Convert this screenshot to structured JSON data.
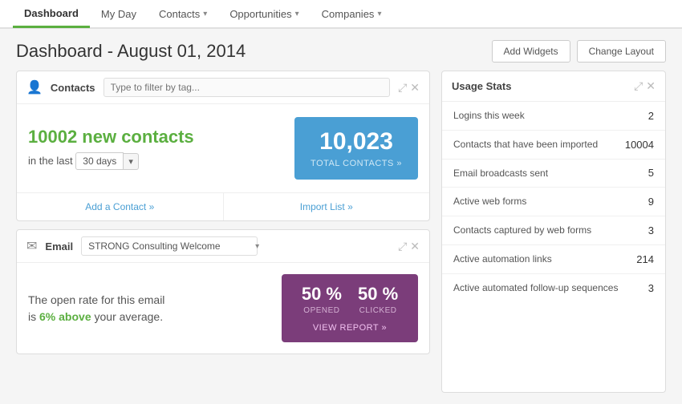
{
  "nav": {
    "items": [
      {
        "label": "Dashboard",
        "active": true,
        "hasChevron": false
      },
      {
        "label": "My Day",
        "active": false,
        "hasChevron": false
      },
      {
        "label": "Contacts",
        "active": false,
        "hasChevron": true
      },
      {
        "label": "Opportunities",
        "active": false,
        "hasChevron": true
      },
      {
        "label": "Companies",
        "active": false,
        "hasChevron": true
      }
    ]
  },
  "header": {
    "title": "Dashboard - August 01, 2014",
    "buttons": {
      "add_widgets": "Add Widgets",
      "change_layout": "Change Layout"
    }
  },
  "contacts_widget": {
    "title": "Contacts",
    "filter_placeholder": "Type to filter by tag...",
    "new_count": "10002 new contacts",
    "in_last": "in the last",
    "days_value": "30 days",
    "total_number": "10,023",
    "total_label": "TOTAL CONTACTS »",
    "footer": {
      "add": "Add a Contact »",
      "import": "Import List »"
    }
  },
  "email_widget": {
    "label": "Email",
    "selected_email": "STRONG Consulting Welcome",
    "body_text_1": "The open rate for this email",
    "body_text_2": "is",
    "highlight": "6% above",
    "body_text_3": "your average.",
    "opened_pct": "50 %",
    "opened_label": "OPENED",
    "clicked_pct": "50 %",
    "clicked_label": "CLICKED",
    "view_report": "VIEW REPORT »"
  },
  "usage_stats": {
    "title": "Usage Stats",
    "rows": [
      {
        "label": "Logins this week",
        "value": "2"
      },
      {
        "label": "Contacts that have been imported",
        "value": "10004"
      },
      {
        "label": "Email broadcasts sent",
        "value": "5"
      },
      {
        "label": "Active web forms",
        "value": "9"
      },
      {
        "label": "Contacts captured by web forms",
        "value": "3"
      },
      {
        "label": "Active automation links",
        "value": "214"
      },
      {
        "label": "Active automated follow-up sequences",
        "value": "3"
      }
    ]
  },
  "icons": {
    "contacts": "👤",
    "email": "✉",
    "expand": "⤢",
    "close": "✕",
    "chevron_down": "▾"
  }
}
